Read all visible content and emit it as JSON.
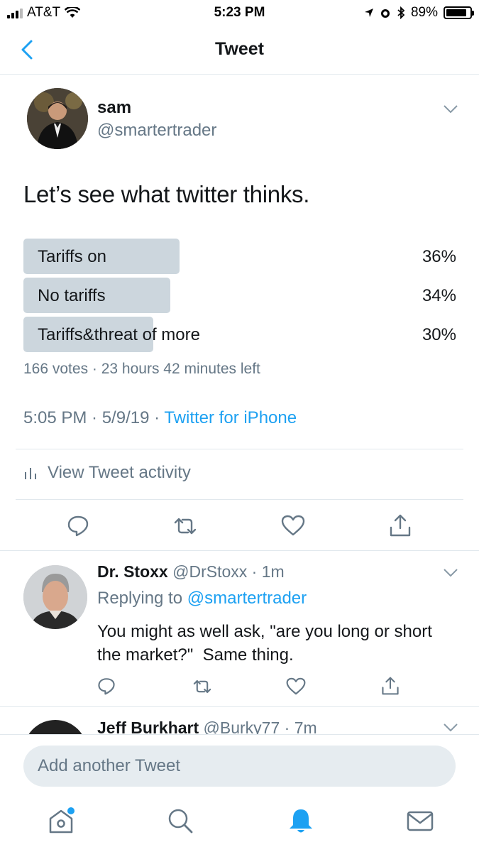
{
  "status_bar": {
    "carrier": "AT&T",
    "time": "5:23 PM",
    "battery_text": "89%",
    "battery_level": 0.89
  },
  "nav": {
    "title": "Tweet",
    "back_icon": "chevron-left-icon"
  },
  "tweet": {
    "author_name": "sam",
    "author_handle": "@smartertrader",
    "text": "Let’s see what twitter thinks.",
    "poll": {
      "options": [
        {
          "label": "Tariffs on",
          "percent": "36%",
          "value": 36
        },
        {
          "label": "No tariffs",
          "percent": "34%",
          "value": 34
        },
        {
          "label": "Tariffs&threat of more",
          "percent": "30%",
          "value": 30
        }
      ],
      "meta": "166 votes · 23 hours 42 minutes left"
    },
    "timestamp": "5:05 PM · 5/9/19 · ",
    "source": "Twitter for iPhone",
    "activity_label": "View Tweet activity",
    "actions": [
      "reply-icon",
      "retweet-icon",
      "like-icon",
      "share-icon"
    ]
  },
  "reply": {
    "name": "Dr. Stoxx",
    "handle": "@DrStoxx · 1m",
    "replying_prefix": "Replying to ",
    "replying_to": "@smartertrader",
    "text": "You might as well ask, \"are you long or short the market?\"  Same thing."
  },
  "third_reply": {
    "name": "Jeff Burkhart",
    "handle": "@Burky77 · 7m"
  },
  "compose": {
    "placeholder": "Add another Tweet"
  },
  "tab_bar": {
    "tabs": [
      "home-icon",
      "search-icon",
      "notifications-icon",
      "messages-icon"
    ],
    "active": "notifications-icon"
  },
  "colors": {
    "accent": "#1da1f2",
    "secondary_text": "#657786",
    "poll_bar": "#ccd6dd",
    "divider": "#e1e8ed"
  }
}
